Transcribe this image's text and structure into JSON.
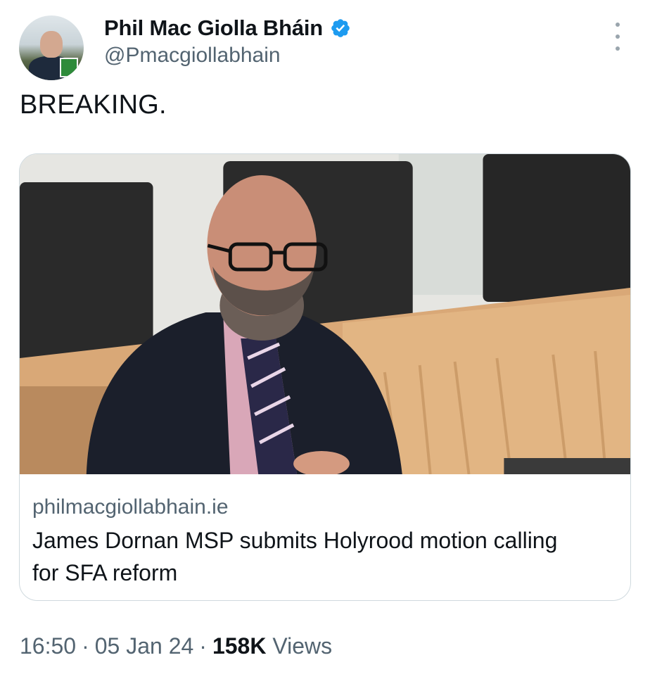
{
  "author": {
    "name": "Phil Mac Giolla Bháin",
    "handle": "@Pmacgiollabhain",
    "verified_color": "#1d9bf0"
  },
  "tweet": {
    "text": "BREAKING."
  },
  "link_card": {
    "domain": "philmacgiollabhain.ie",
    "title": "James Dornan MSP submits Holyrood motion calling for SFA reform"
  },
  "meta": {
    "time": "16:50",
    "date": "05 Jan 24",
    "separator": "·",
    "views_count": "158K",
    "views_label": "Views"
  },
  "icons": {
    "verified": "verified-badge-icon",
    "more": "more-options-icon"
  }
}
